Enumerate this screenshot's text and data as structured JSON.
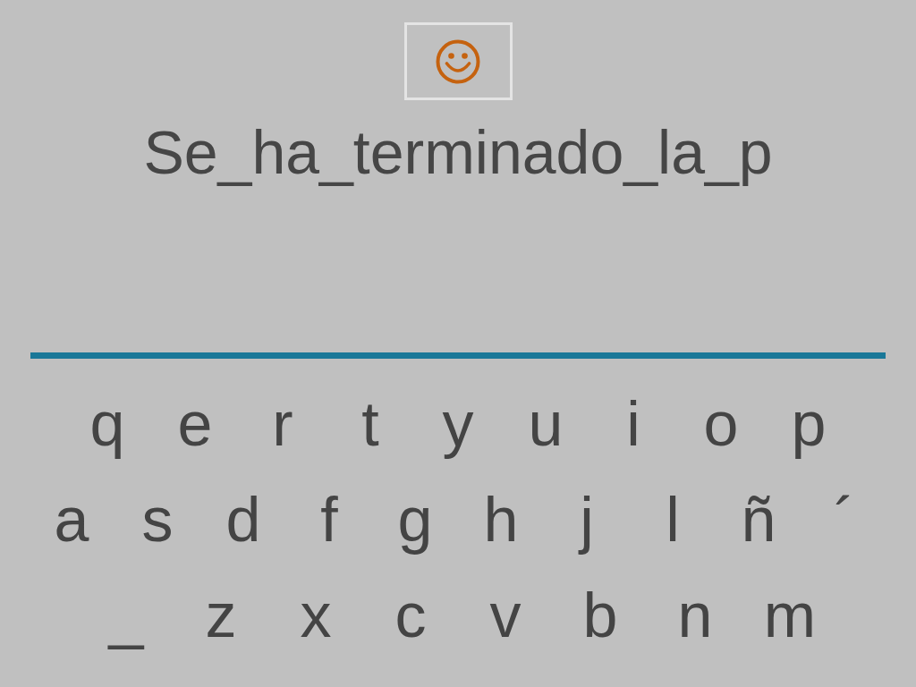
{
  "feedback": {
    "kind": "happy"
  },
  "answer": {
    "value": "Se_ha_terminado_la_p"
  },
  "keyboard": {
    "rows": [
      [
        "q",
        "e",
        "r",
        "t",
        "y",
        "u",
        "i",
        "o",
        "p"
      ],
      [
        "a",
        "s",
        "d",
        "f",
        "g",
        "h",
        "j",
        "l",
        "ñ",
        "´"
      ],
      [
        "_",
        "z",
        "x",
        "c",
        "v",
        "b",
        "n",
        "m"
      ]
    ]
  }
}
